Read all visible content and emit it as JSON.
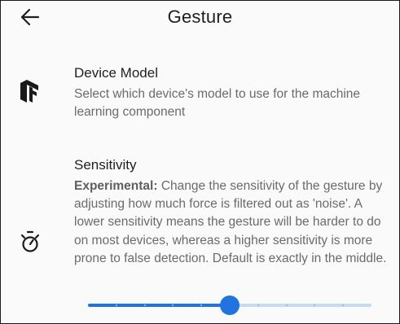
{
  "header": {
    "title": "Gesture",
    "back_icon": "arrow-left-icon"
  },
  "device_model": {
    "icon": "tensorflow-icon",
    "title": "Device Model",
    "description": "Select which device's model to use for the machine learning component"
  },
  "sensitivity": {
    "icon": "stopwatch-icon",
    "title": "Sensitivity",
    "description_bold": "Experimental:",
    "description_rest": " Change the sensitivity of the gesture by adjusting how much force is filtered out as 'noise'. A lower sensitivity means the gesture will be harder to do on most devices, whereas a higher sensitivity is more prone to false detection. Default is exactly in the middle.",
    "slider": {
      "min": 0,
      "max": 10,
      "step": 1,
      "value": 5
    }
  },
  "colors": {
    "accent": "#2173e0",
    "track_inactive": "#c4dcf3",
    "tick_on_active": "#9ec4f2",
    "tick_on_inactive": "#8fb6e6"
  }
}
